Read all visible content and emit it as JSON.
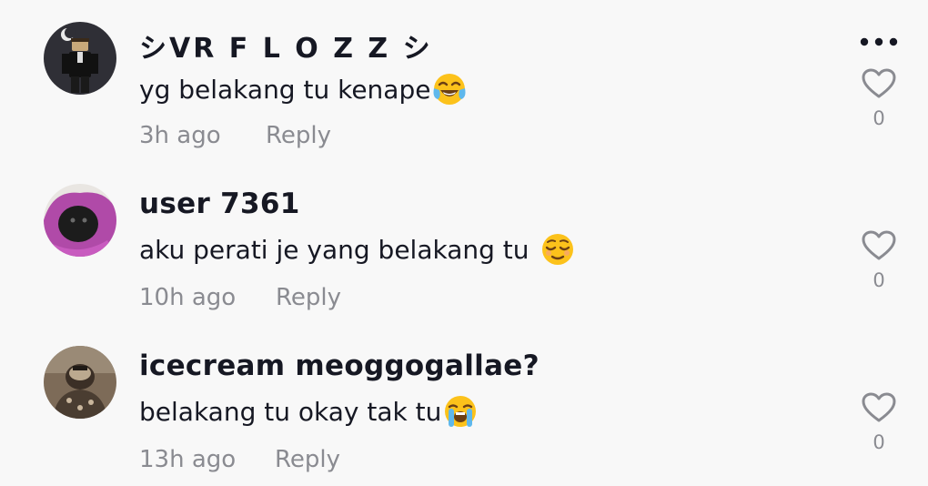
{
  "comments": [
    {
      "username": "シVR F L O Z Z シ",
      "text": "yg belakang tu kenape",
      "emoji_icon": "face-with-tears-of-joy-icon",
      "time": "3h ago",
      "reply_label": "Reply",
      "likes": "0"
    },
    {
      "username": "user 7361",
      "text": "aku perati je yang belakang tu",
      "emoji_icon": "relieved-face-icon",
      "time": "10h ago",
      "reply_label": "Reply",
      "likes": "0"
    },
    {
      "username": "icecream meoggogallae?",
      "text": "belakang tu okay tak tu",
      "emoji_icon": "loudly-crying-face-icon",
      "time": "13h ago",
      "reply_label": "Reply",
      "likes": "0"
    }
  ],
  "more_icon": "more-options-icon",
  "colors": {
    "background": "#f8f8f8",
    "text": "#161823",
    "muted": "#8a8b91"
  }
}
